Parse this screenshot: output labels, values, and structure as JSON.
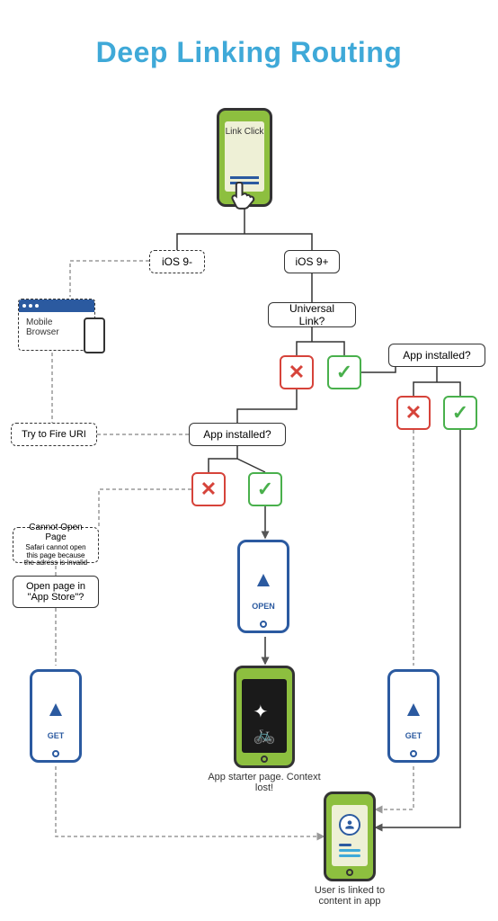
{
  "title": "Deep Linking Routing",
  "diagram": {
    "start": {
      "label": "Link Click"
    },
    "ios_old": "iOS 9-",
    "ios_new": "iOS 9+",
    "universal_link": "Universal Link?",
    "app_installed_left": "App installed?",
    "app_installed_right": "App installed?",
    "mobile_browser": "Mobile Browser",
    "try_fire_uri": "Try to Fire URI",
    "cannot_open_title": "Cannot Open Page",
    "cannot_open_detail": "Safari cannot open this page because the adress is invalid",
    "open_in_appstore": "Open page in \"App Store\"?",
    "open_label": "OPEN",
    "get_label_left": "GET",
    "get_label_right": "GET",
    "starter_caption": "App starter page. Context lost!",
    "deeplink_caption": "User is linked to content in app"
  },
  "colors": {
    "title": "#3fa9d8",
    "yes": "#49b04c",
    "no": "#d6433a",
    "accent_blue": "#2b5aa0",
    "phone_green": "#8dbf3f"
  }
}
